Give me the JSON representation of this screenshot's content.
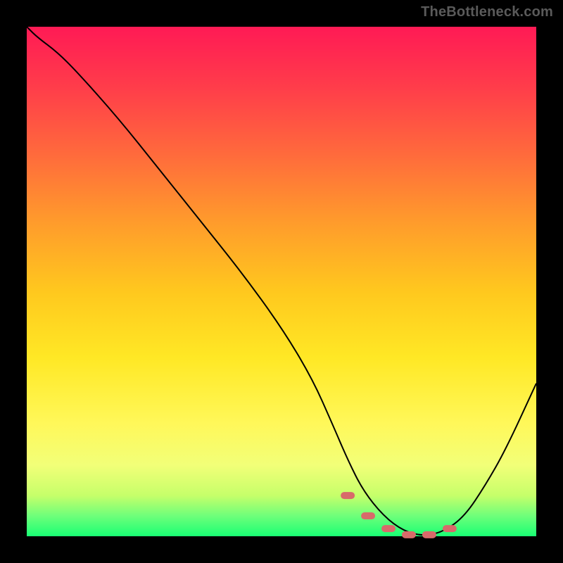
{
  "watermark": "TheBottleneck.com",
  "chart_data": {
    "type": "line",
    "title": "",
    "xlabel": "",
    "ylabel": "",
    "xlim": [
      0,
      100
    ],
    "ylim": [
      0,
      100
    ],
    "grid": false,
    "series": [
      {
        "name": "bottleneck-curve",
        "color": "#000000",
        "x": [
          0,
          2,
          6,
          10,
          18,
          26,
          34,
          42,
          50,
          56,
          60,
          63,
          66,
          70,
          74,
          78,
          82,
          86,
          90,
          94,
          100
        ],
        "values": [
          100,
          98,
          95,
          91,
          82,
          72,
          62,
          52,
          41,
          31,
          22,
          15,
          9,
          4,
          1,
          0,
          1,
          4,
          10,
          17,
          30
        ]
      }
    ],
    "markers": {
      "name": "optimal-range",
      "color": "#d86a6a",
      "shape": "rounded-dash",
      "x": [
        63,
        67,
        71,
        75,
        79,
        83
      ],
      "values": [
        8,
        4,
        1.5,
        0.3,
        0.3,
        1.5
      ]
    }
  }
}
